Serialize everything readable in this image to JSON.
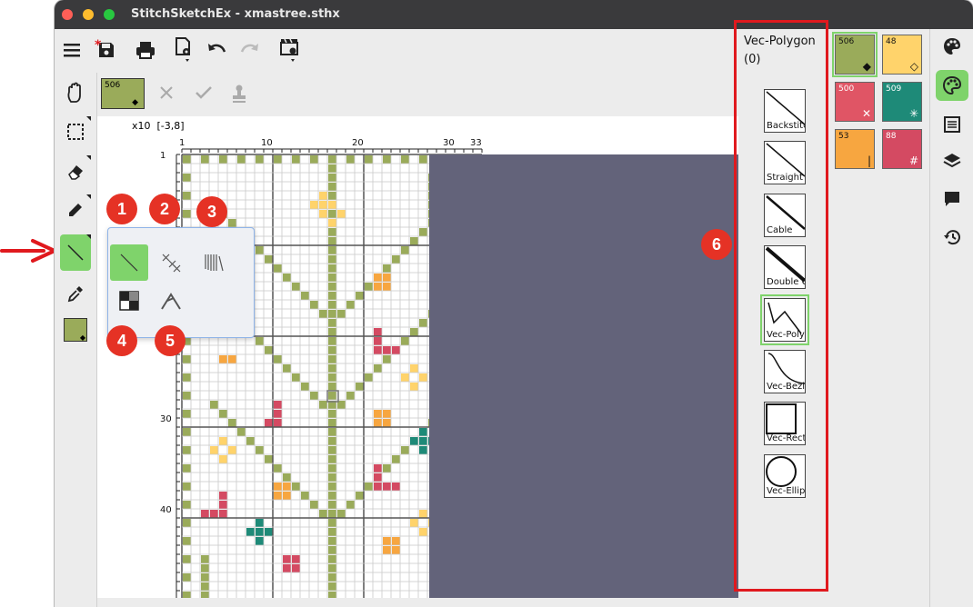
{
  "window": {
    "title": "StitchSketchEx - xmastree.sthx"
  },
  "toolbar": {
    "items": [
      "menu-icon",
      "save-icon",
      "print-icon",
      "file-settings-icon",
      "undo-icon",
      "redo-icon",
      "movie-settings-icon"
    ],
    "modified_marker": "*"
  },
  "current_color": {
    "number": "506",
    "symbol": "◆",
    "color": "#9aab5a"
  },
  "ruler": {
    "scale_label": "x10",
    "coords": "[-3,8]",
    "top_ticks": [
      "1",
      "10",
      "20",
      "30",
      "33"
    ],
    "left_ticks": [
      "1",
      "30",
      "40"
    ]
  },
  "badges": [
    "1",
    "2",
    "3",
    "4",
    "5",
    "6"
  ],
  "style_panel": {
    "title": "Vec-Polygon",
    "count": "(0)",
    "items": [
      "Backstitch",
      "Straight",
      "Cable",
      "Double C",
      "Vec-Polyg",
      "Vec-Bezie",
      "Vec-Recta",
      "Vec-Ellips"
    ],
    "selected": "Vec-Polyg"
  },
  "swatches": [
    {
      "num": "506",
      "sym": "◆",
      "color": "#9aab5a",
      "text": "#111"
    },
    {
      "num": "48",
      "sym": "◇",
      "color": "#ffd36b",
      "text": "#111"
    },
    {
      "num": "500",
      "sym": "✕",
      "color": "#e05565",
      "text": "#fff"
    },
    {
      "num": "509",
      "sym": "✳",
      "color": "#1e8a78",
      "text": "#fff"
    },
    {
      "num": "53",
      "sym": "|",
      "color": "#f7a640",
      "text": "#111"
    },
    {
      "num": "88",
      "sym": "#",
      "color": "#d44a62",
      "text": "#fff"
    }
  ],
  "colors": {
    "accent_green": "#7fd36b",
    "highlight_red": "#e0191e",
    "canvas_dark": "#63637a"
  }
}
